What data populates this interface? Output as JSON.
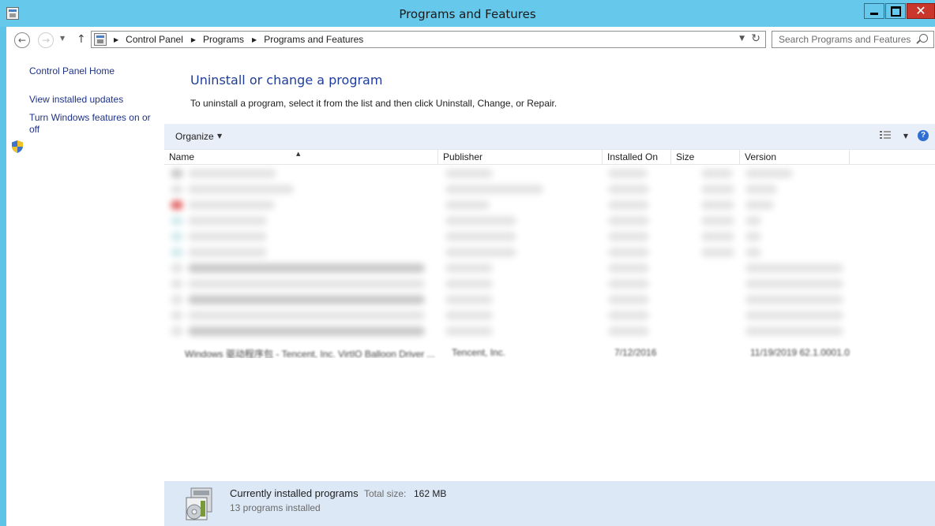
{
  "window": {
    "title": "Programs and Features",
    "close_glyph": "✕"
  },
  "nav": {
    "back_glyph": "←",
    "forward_glyph": "→",
    "up_glyph": "↑",
    "history_caret": "▼",
    "breadcrumbs": [
      "Control Panel",
      "Programs",
      "Programs and Features"
    ],
    "crumb_sep": "▶",
    "address_caret": "▼",
    "refresh_glyph": "↻",
    "search_placeholder": "Search Programs and Features"
  },
  "sidebar": {
    "items": [
      {
        "label": "Control Panel Home"
      },
      {
        "label": "View installed updates"
      },
      {
        "label": "Turn Windows features on or off",
        "icon": "shield-icon"
      }
    ]
  },
  "main": {
    "title": "Uninstall or change a program",
    "description": "To uninstall a program, select it from the list and then click Uninstall, Change, or Repair."
  },
  "toolbar": {
    "organize_label": "Organize",
    "caret": "▼",
    "help_glyph": "?"
  },
  "columns": [
    {
      "label": "Name",
      "sorted": "ascending",
      "sort_glyph": "▲"
    },
    {
      "label": "Publisher"
    },
    {
      "label": "Installed On"
    },
    {
      "label": "Size"
    },
    {
      "label": "Version"
    }
  ],
  "visible_row": {
    "name": "Windows 驱动程序包 - Tencent, Inc. VirtIO Balloon Driver ...",
    "publisher": "Tencent, Inc.",
    "installed_on": "7/12/2016",
    "version": "11/19/2019 62.1.0001.0"
  },
  "footer": {
    "title": "Currently installed programs",
    "total_label": "Total size:",
    "total_value": "162 MB",
    "count_text": "13 programs installed"
  },
  "colors": {
    "titlebar": "#66c8ea",
    "link": "#1e3287",
    "heading": "#1e3d9a",
    "toolbar_bg": "#e8eff8",
    "footer_bg": "#dce8f5",
    "close_button": "#c9372c"
  }
}
